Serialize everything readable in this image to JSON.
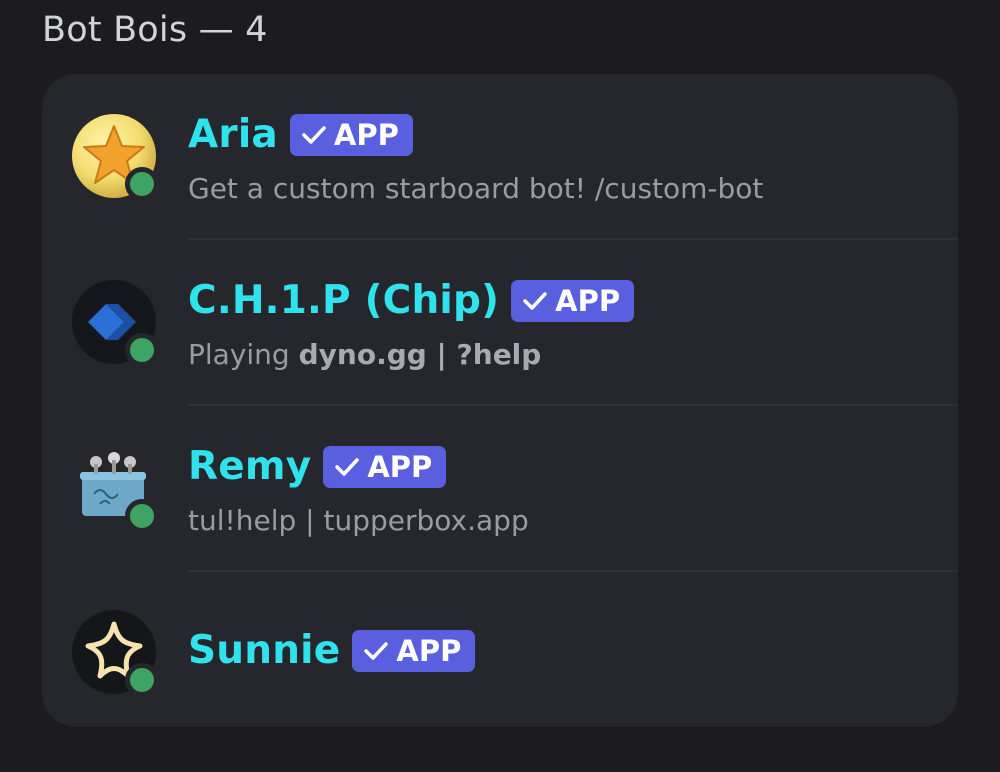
{
  "section": {
    "title": "Bot Bois — 4"
  },
  "members": [
    {
      "name": "Aria",
      "tag": "APP",
      "status": "Get a custom starboard bot! /custom-bot",
      "avatar_icon": "gold-star-avatar",
      "presence": "online"
    },
    {
      "name": "C.H.1.P (Chip)",
      "tag": "APP",
      "status_prefix": "Playing",
      "status_game": "dyno.gg | ?help",
      "avatar_icon": "blue-diamond-arrow-avatar",
      "presence": "online"
    },
    {
      "name": "Remy",
      "tag": "APP",
      "status": "tul!help | tupperbox.app",
      "avatar_icon": "tupperware-box-avatar",
      "presence": "online"
    },
    {
      "name": "Sunnie",
      "tag": "APP",
      "avatar_icon": "sparkle-star-avatar",
      "presence": "online"
    }
  ],
  "colors": {
    "name": "#2fe2ec",
    "app_tag": "#5a5fe0",
    "online": "#3ea363",
    "card_bg": "#26262d",
    "page_bg": "#1b1b20"
  }
}
